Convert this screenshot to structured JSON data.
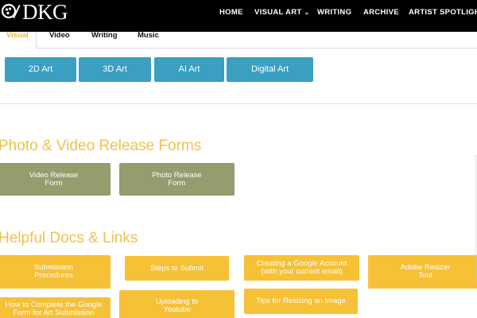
{
  "header": {
    "logo_text": "DKG",
    "logo_icon": "dkg-emblem-icon",
    "nav": {
      "home": "HOME",
      "visual_art": "VISUAL ART",
      "writing": "WRITING",
      "archive": "ARCHIVE",
      "artist_spotlight": "ARTIST SPOTLIGHT"
    },
    "chevron_icon": "chevron-down-icon"
  },
  "tabs": {
    "visual": "Visual",
    "video": "Video",
    "writing": "Writing",
    "music": "Music",
    "active": "Visual"
  },
  "art_buttons": {
    "b2d": "2D Art",
    "b3d": "3D Art",
    "ai": "AI Art",
    "digital": "Digital Art"
  },
  "release_forms": {
    "title": "Photo & Video Release Forms",
    "video": "Video Release Form",
    "photo": "Photo Release Form"
  },
  "helpful": {
    "title": "Helpful Docs & Links",
    "submission_procedures": "Submission Procedures",
    "steps_to_submit": "Steps to Submit",
    "google_account": "Creating a Google Account (with your current email)",
    "adobe_resizer": "Adobe Resizer Tool",
    "complete_google_form": "How to Complete the Google Form for Art Submission",
    "uploading_youtube": "Uploading to Youtube",
    "tips_resizing": "Tips for Resizing an Image"
  },
  "colors": {
    "header_bg": "#000000",
    "tab_active": "#e6b83a",
    "art_button": "#3a9fc1",
    "section_title": "#f2c14a",
    "form_button": "#939d6d",
    "doc_button": "#f6c137"
  }
}
